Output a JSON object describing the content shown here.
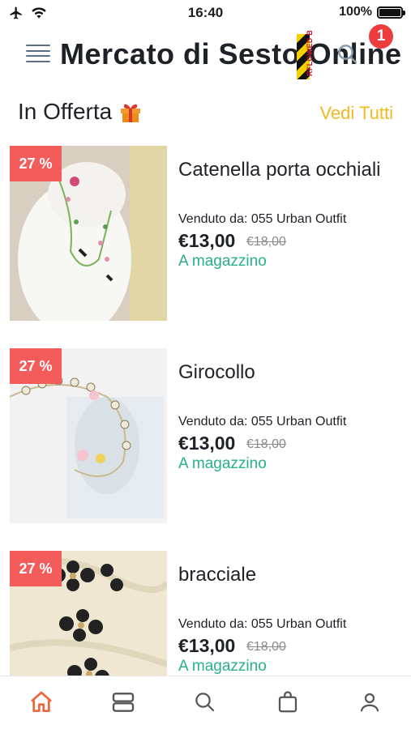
{
  "status_bar": {
    "time": "16:40",
    "battery": "100%",
    "battery_level": 1.0
  },
  "header": {
    "title": "Mercato di Sesto Online",
    "notification_count": "1",
    "badge_text": "RFLOWED BY"
  },
  "section": {
    "title": "In Offerta",
    "see_all": "Vedi Tutti"
  },
  "products": [
    {
      "discount": "27 %",
      "name": "Catenella porta occhiali",
      "seller_label": "Venduto da:",
      "seller": "055 Urban Outfit",
      "price": "€13,00",
      "old_price": "€18,00",
      "stock": "A magazzino"
    },
    {
      "discount": "27 %",
      "name": "Girocollo",
      "seller_label": "Venduto da:",
      "seller": "055 Urban Outfit",
      "price": "€13,00",
      "old_price": "€18,00",
      "stock": "A magazzino"
    },
    {
      "discount": "27 %",
      "name": "bracciale",
      "seller_label": "Venduto da:",
      "seller": "055 Urban Outfit",
      "price": "€13,00",
      "old_price": "€18,00",
      "stock": "A magazzino"
    }
  ],
  "bottom_nav": {
    "items": [
      "home-icon",
      "categories-icon",
      "search-icon",
      "shopping-bag-icon",
      "user-icon"
    ],
    "active": "home-icon"
  },
  "colors": {
    "accent": "#f45b5b",
    "link": "#f5b820",
    "stock": "#27b08a",
    "nav_active": "#f0653b"
  }
}
